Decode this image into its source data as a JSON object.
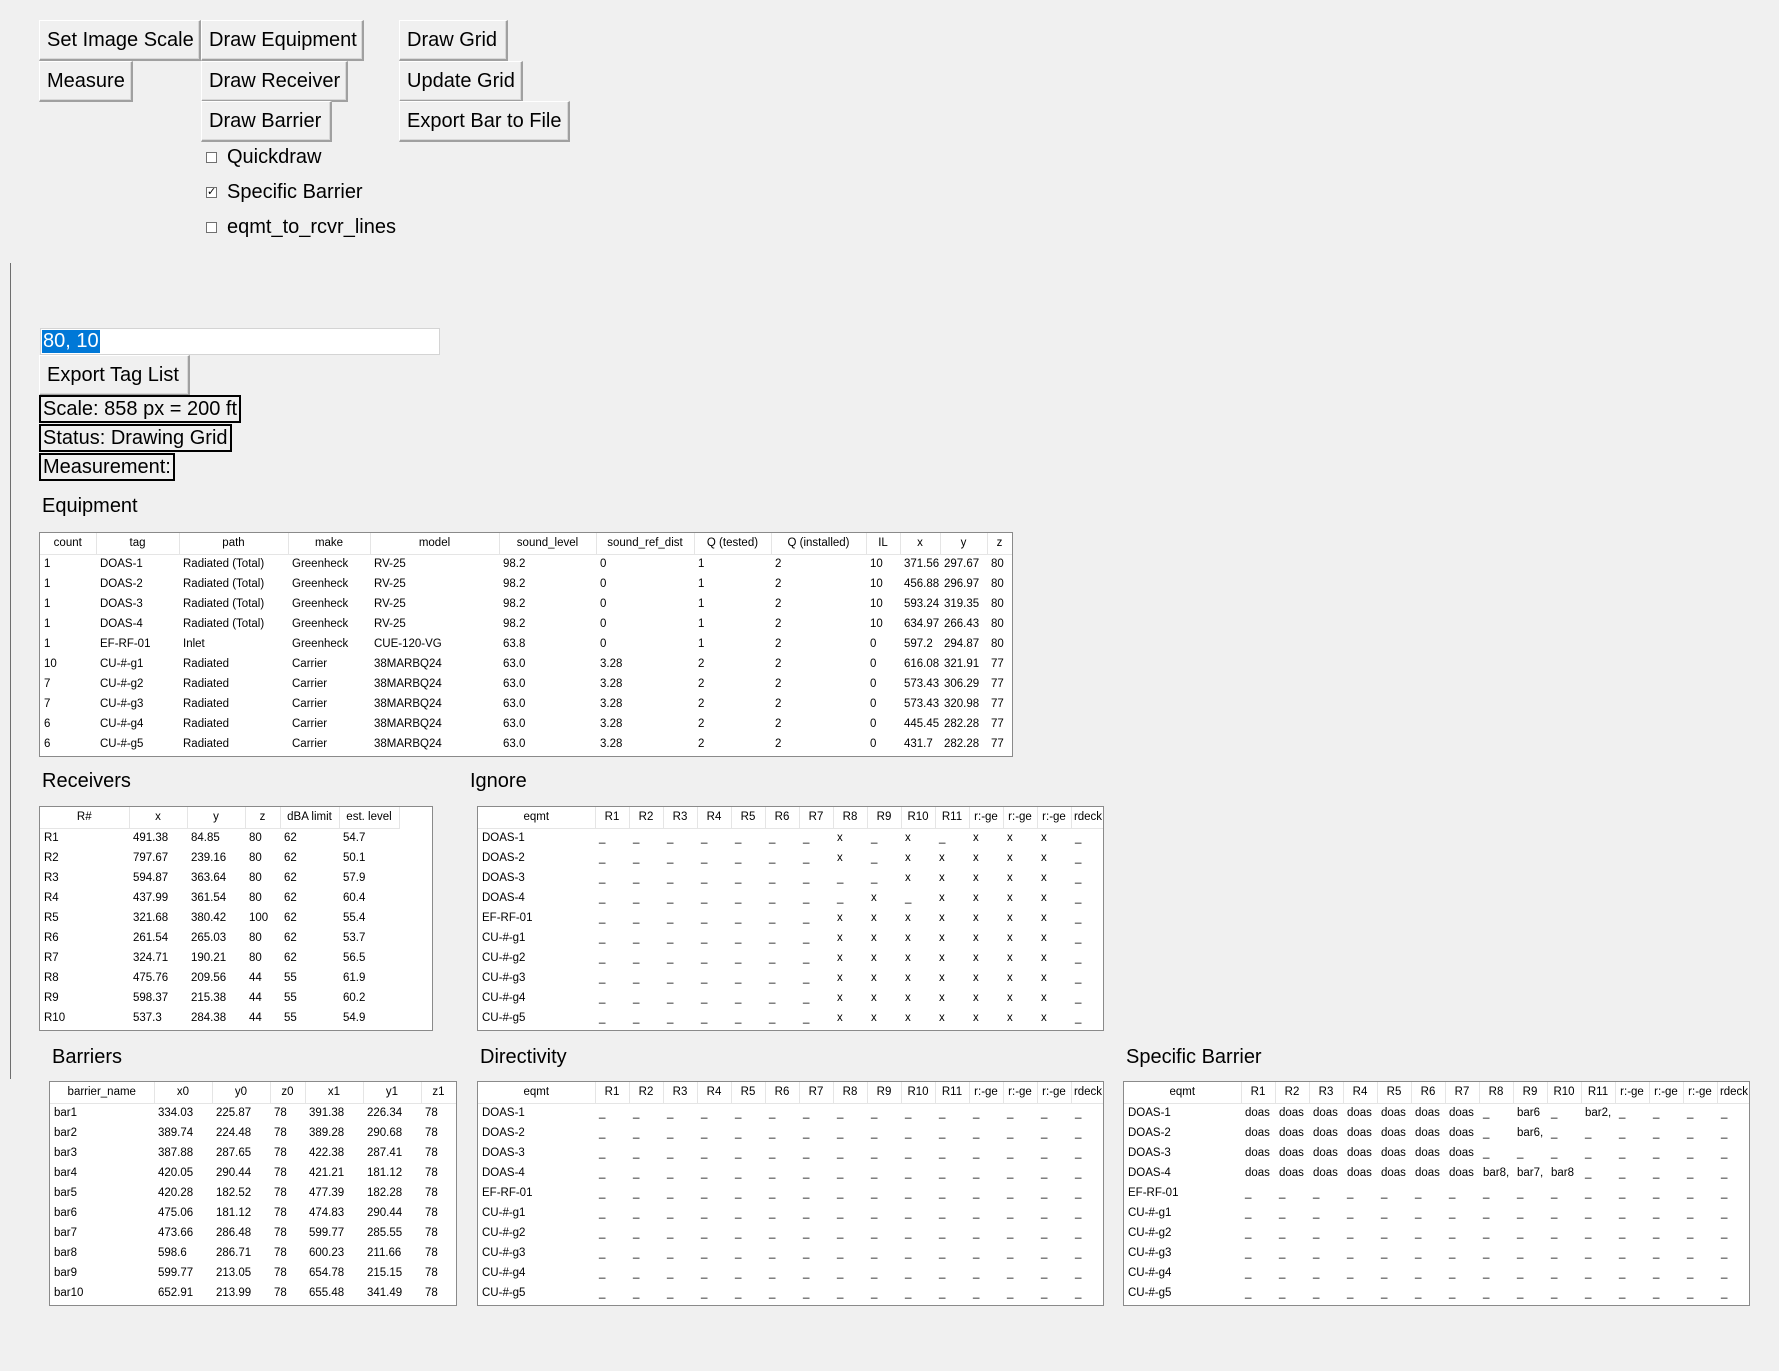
{
  "buttons": {
    "set_image_scale": "Set Image Scale",
    "draw_equipment": "Draw Equipment",
    "draw_grid": "Draw Grid",
    "measure": "Measure",
    "draw_receiver": "Draw Receiver",
    "update_grid": "Update Grid",
    "draw_barrier": "Draw Barrier",
    "export_bar": "Export Bar to File",
    "export_tag_list": "Export Tag List"
  },
  "checkboxes": {
    "quickdraw": {
      "label": "Quickdraw",
      "checked": false
    },
    "specific_barrier": {
      "label": "Specific Barrier",
      "checked": true
    },
    "eqmt_lines": {
      "label": "eqmt_to_rcvr_lines",
      "checked": false
    }
  },
  "entry": {
    "value": "80, 10"
  },
  "labels": {
    "scale": "Scale: 858 px = 200 ft",
    "status": "Status: Drawing Grid",
    "measurement": "Measurement:"
  },
  "equipment": {
    "title": "Equipment",
    "columns": [
      "count",
      "tag",
      "path",
      "make",
      "model",
      "sound_level",
      "sound_ref_dist",
      "Q (tested)",
      "Q (installed)",
      "IL",
      "x",
      "y",
      "z"
    ],
    "rows": [
      [
        "1",
        "DOAS-1",
        "Radiated (Total)",
        "Greenheck",
        "RV-25",
        "98.2",
        "0",
        "1",
        "2",
        "10",
        "371.56",
        "297.67",
        "80"
      ],
      [
        "1",
        "DOAS-2",
        "Radiated (Total)",
        "Greenheck",
        "RV-25",
        "98.2",
        "0",
        "1",
        "2",
        "10",
        "456.88",
        "296.97",
        "80"
      ],
      [
        "1",
        "DOAS-3",
        "Radiated (Total)",
        "Greenheck",
        "RV-25",
        "98.2",
        "0",
        "1",
        "2",
        "10",
        "593.24",
        "319.35",
        "80"
      ],
      [
        "1",
        "DOAS-4",
        "Radiated (Total)",
        "Greenheck",
        "RV-25",
        "98.2",
        "0",
        "1",
        "2",
        "10",
        "634.97",
        "266.43",
        "80"
      ],
      [
        "1",
        "EF-RF-01",
        "Inlet",
        "Greenheck",
        "CUE-120-VG",
        "63.8",
        "0",
        "1",
        "2",
        "0",
        "597.2",
        "294.87",
        "80"
      ],
      [
        "10",
        "CU-#-g1",
        "Radiated",
        "Carrier",
        "38MARBQ24",
        "63.0",
        "3.28",
        "2",
        "2",
        "0",
        "616.08",
        "321.91",
        "77"
      ],
      [
        "7",
        "CU-#-g2",
        "Radiated",
        "Carrier",
        "38MARBQ24",
        "63.0",
        "3.28",
        "2",
        "2",
        "0",
        "573.43",
        "306.29",
        "77"
      ],
      [
        "7",
        "CU-#-g3",
        "Radiated",
        "Carrier",
        "38MARBQ24",
        "63.0",
        "3.28",
        "2",
        "2",
        "0",
        "573.43",
        "320.98",
        "77"
      ],
      [
        "6",
        "CU-#-g4",
        "Radiated",
        "Carrier",
        "38MARBQ24",
        "63.0",
        "3.28",
        "2",
        "2",
        "0",
        "445.45",
        "282.28",
        "77"
      ],
      [
        "6",
        "CU-#-g5",
        "Radiated",
        "Carrier",
        "38MARBQ24",
        "63.0",
        "3.28",
        "2",
        "2",
        "0",
        "431.7",
        "282.28",
        "77"
      ]
    ]
  },
  "receivers": {
    "title": "Receivers",
    "columns": [
      "R#",
      "x",
      "y",
      "z",
      "dBA limit",
      "est. level"
    ],
    "rows": [
      [
        "R1",
        "491.38",
        "84.85",
        "80",
        "62",
        "54.7"
      ],
      [
        "R2",
        "797.67",
        "239.16",
        "80",
        "62",
        "50.1"
      ],
      [
        "R3",
        "594.87",
        "363.64",
        "80",
        "62",
        "57.9"
      ],
      [
        "R4",
        "437.99",
        "361.54",
        "80",
        "62",
        "60.4"
      ],
      [
        "R5",
        "321.68",
        "380.42",
        "100",
        "62",
        "55.4"
      ],
      [
        "R6",
        "261.54",
        "265.03",
        "80",
        "62",
        "53.7"
      ],
      [
        "R7",
        "324.71",
        "190.21",
        "80",
        "62",
        "56.5"
      ],
      [
        "R8",
        "475.76",
        "209.56",
        "44",
        "55",
        "61.9"
      ],
      [
        "R9",
        "598.37",
        "215.38",
        "44",
        "55",
        "60.2"
      ],
      [
        "R10",
        "537.3",
        "284.38",
        "44",
        "55",
        "54.9"
      ]
    ]
  },
  "ignore": {
    "title": "Ignore",
    "columns": [
      "eqmt",
      "R1",
      "R2",
      "R3",
      "R4",
      "R5",
      "R6",
      "R7",
      "R8",
      "R9",
      "R10",
      "R11",
      "r:-ge",
      "r:-ge",
      "r:-ge",
      "rdeck"
    ],
    "rows": [
      [
        "DOAS-1",
        "_",
        "_",
        "_",
        "_",
        "_",
        "_",
        "_",
        "x",
        "_",
        "x",
        "_",
        "x",
        "x",
        "x",
        "_"
      ],
      [
        "DOAS-2",
        "_",
        "_",
        "_",
        "_",
        "_",
        "_",
        "_",
        "x",
        "_",
        "x",
        "x",
        "x",
        "x",
        "x",
        "_"
      ],
      [
        "DOAS-3",
        "_",
        "_",
        "_",
        "_",
        "_",
        "_",
        "_",
        "_",
        "_",
        "x",
        "x",
        "x",
        "x",
        "x",
        "_"
      ],
      [
        "DOAS-4",
        "_",
        "_",
        "_",
        "_",
        "_",
        "_",
        "_",
        "_",
        "x",
        "_",
        "x",
        "x",
        "x",
        "x",
        "_"
      ],
      [
        "EF-RF-01",
        "_",
        "_",
        "_",
        "_",
        "_",
        "_",
        "_",
        "x",
        "x",
        "x",
        "x",
        "x",
        "x",
        "x",
        "_"
      ],
      [
        "CU-#-g1",
        "_",
        "_",
        "_",
        "_",
        "_",
        "_",
        "_",
        "x",
        "x",
        "x",
        "x",
        "x",
        "x",
        "x",
        "_"
      ],
      [
        "CU-#-g2",
        "_",
        "_",
        "_",
        "_",
        "_",
        "_",
        "_",
        "x",
        "x",
        "x",
        "x",
        "x",
        "x",
        "x",
        "_"
      ],
      [
        "CU-#-g3",
        "_",
        "_",
        "_",
        "_",
        "_",
        "_",
        "_",
        "x",
        "x",
        "x",
        "x",
        "x",
        "x",
        "x",
        "_"
      ],
      [
        "CU-#-g4",
        "_",
        "_",
        "_",
        "_",
        "_",
        "_",
        "_",
        "x",
        "x",
        "x",
        "x",
        "x",
        "x",
        "x",
        "_"
      ],
      [
        "CU-#-g5",
        "_",
        "_",
        "_",
        "_",
        "_",
        "_",
        "_",
        "x",
        "x",
        "x",
        "x",
        "x",
        "x",
        "x",
        "_"
      ]
    ]
  },
  "barriers": {
    "title": "Barriers",
    "columns": [
      "barrier_name",
      "x0",
      "y0",
      "z0",
      "x1",
      "y1",
      "z1"
    ],
    "rows": [
      [
        "bar1",
        "334.03",
        "225.87",
        "78",
        "391.38",
        "226.34",
        "78"
      ],
      [
        "bar2",
        "389.74",
        "224.48",
        "78",
        "389.28",
        "290.68",
        "78"
      ],
      [
        "bar3",
        "387.88",
        "287.65",
        "78",
        "422.38",
        "287.41",
        "78"
      ],
      [
        "bar4",
        "420.05",
        "290.44",
        "78",
        "421.21",
        "181.12",
        "78"
      ],
      [
        "bar5",
        "420.28",
        "182.52",
        "78",
        "477.39",
        "182.28",
        "78"
      ],
      [
        "bar6",
        "475.06",
        "181.12",
        "78",
        "474.83",
        "290.44",
        "78"
      ],
      [
        "bar7",
        "473.66",
        "286.48",
        "78",
        "599.77",
        "285.55",
        "78"
      ],
      [
        "bar8",
        "598.6",
        "286.71",
        "78",
        "600.23",
        "211.66",
        "78"
      ],
      [
        "bar9",
        "599.77",
        "213.05",
        "78",
        "654.78",
        "215.15",
        "78"
      ],
      [
        "bar10",
        "652.91",
        "213.99",
        "78",
        "655.48",
        "341.49",
        "78"
      ]
    ]
  },
  "directivity": {
    "title": "Directivity",
    "columns": [
      "eqmt",
      "R1",
      "R2",
      "R3",
      "R4",
      "R5",
      "R6",
      "R7",
      "R8",
      "R9",
      "R10",
      "R11",
      "r:-ge",
      "r:-ge",
      "r:-ge",
      "rdeck"
    ],
    "rows": [
      [
        "DOAS-1",
        "_",
        "_",
        "_",
        "_",
        "_",
        "_",
        "_",
        "_",
        "_",
        "_",
        "_",
        "_",
        "_",
        "_",
        "_"
      ],
      [
        "DOAS-2",
        "_",
        "_",
        "_",
        "_",
        "_",
        "_",
        "_",
        "_",
        "_",
        "_",
        "_",
        "_",
        "_",
        "_",
        "_"
      ],
      [
        "DOAS-3",
        "_",
        "_",
        "_",
        "_",
        "_",
        "_",
        "_",
        "_",
        "_",
        "_",
        "_",
        "_",
        "_",
        "_",
        "_"
      ],
      [
        "DOAS-4",
        "_",
        "_",
        "_",
        "_",
        "_",
        "_",
        "_",
        "_",
        "_",
        "_",
        "_",
        "_",
        "_",
        "_",
        "_"
      ],
      [
        "EF-RF-01",
        "_",
        "_",
        "_",
        "_",
        "_",
        "_",
        "_",
        "_",
        "_",
        "_",
        "_",
        "_",
        "_",
        "_",
        "_"
      ],
      [
        "CU-#-g1",
        "_",
        "_",
        "_",
        "_",
        "_",
        "_",
        "_",
        "_",
        "_",
        "_",
        "_",
        "_",
        "_",
        "_",
        "_"
      ],
      [
        "CU-#-g2",
        "_",
        "_",
        "_",
        "_",
        "_",
        "_",
        "_",
        "_",
        "_",
        "_",
        "_",
        "_",
        "_",
        "_",
        "_"
      ],
      [
        "CU-#-g3",
        "_",
        "_",
        "_",
        "_",
        "_",
        "_",
        "_",
        "_",
        "_",
        "_",
        "_",
        "_",
        "_",
        "_",
        "_"
      ],
      [
        "CU-#-g4",
        "_",
        "_",
        "_",
        "_",
        "_",
        "_",
        "_",
        "_",
        "_",
        "_",
        "_",
        "_",
        "_",
        "_",
        "_"
      ],
      [
        "CU-#-g5",
        "_",
        "_",
        "_",
        "_",
        "_",
        "_",
        "_",
        "_",
        "_",
        "_",
        "_",
        "_",
        "_",
        "_",
        "_"
      ]
    ]
  },
  "specific_barrier": {
    "title": "Specific Barrier",
    "columns": [
      "eqmt",
      "R1",
      "R2",
      "R3",
      "R4",
      "R5",
      "R6",
      "R7",
      "R8",
      "R9",
      "R10",
      "R11",
      "r:-ge",
      "r:-ge",
      "r:-ge",
      "rdeck"
    ],
    "rows": [
      [
        "DOAS-1",
        "doas",
        "doas",
        "doas",
        "doas",
        "doas",
        "doas",
        "doas",
        "_",
        "bar6",
        "_",
        "bar2,",
        "_",
        "_",
        "_",
        "_"
      ],
      [
        "DOAS-2",
        "doas",
        "doas",
        "doas",
        "doas",
        "doas",
        "doas",
        "doas",
        "_",
        "bar6,",
        "_",
        "_",
        "_",
        "_",
        "_",
        "_"
      ],
      [
        "DOAS-3",
        "doas",
        "doas",
        "doas",
        "doas",
        "doas",
        "doas",
        "doas",
        "_",
        "_",
        "_",
        "_",
        "_",
        "_",
        "_",
        "_"
      ],
      [
        "DOAS-4",
        "doas",
        "doas",
        "doas",
        "doas",
        "doas",
        "doas",
        "doas",
        "bar8,",
        "bar7,",
        "bar8",
        "_",
        "_",
        "_",
        "_",
        "_"
      ],
      [
        "EF-RF-01",
        "_",
        "_",
        "_",
        "_",
        "_",
        "_",
        "_",
        "_",
        "_",
        "_",
        "_",
        "_",
        "_",
        "_",
        "_"
      ],
      [
        "CU-#-g1",
        "_",
        "_",
        "_",
        "_",
        "_",
        "_",
        "_",
        "_",
        "_",
        "_",
        "_",
        "_",
        "_",
        "_",
        "_"
      ],
      [
        "CU-#-g2",
        "_",
        "_",
        "_",
        "_",
        "_",
        "_",
        "_",
        "_",
        "_",
        "_",
        "_",
        "_",
        "_",
        "_",
        "_"
      ],
      [
        "CU-#-g3",
        "_",
        "_",
        "_",
        "_",
        "_",
        "_",
        "_",
        "_",
        "_",
        "_",
        "_",
        "_",
        "_",
        "_",
        "_"
      ],
      [
        "CU-#-g4",
        "_",
        "_",
        "_",
        "_",
        "_",
        "_",
        "_",
        "_",
        "_",
        "_",
        "_",
        "_",
        "_",
        "_",
        "_"
      ],
      [
        "CU-#-g5",
        "_",
        "_",
        "_",
        "_",
        "_",
        "_",
        "_",
        "_",
        "_",
        "_",
        "_",
        "_",
        "_",
        "_",
        "_"
      ]
    ]
  }
}
